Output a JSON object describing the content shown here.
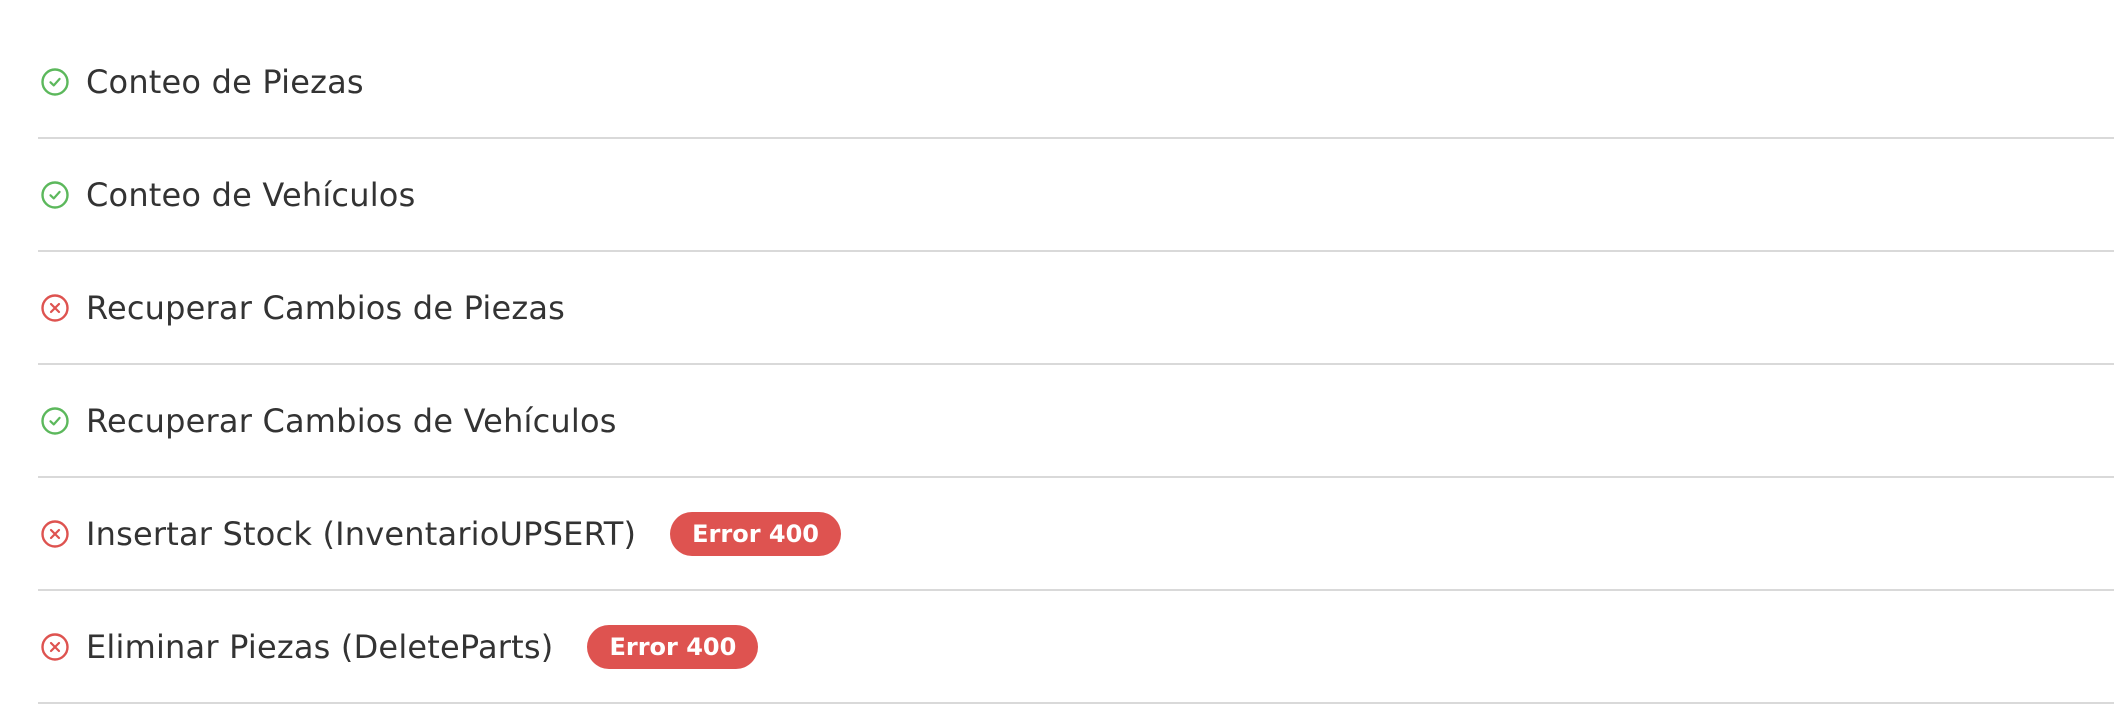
{
  "colors": {
    "success": "#5cb85c",
    "error": "#de5350",
    "text": "#333333",
    "divider": "#d9d9d9"
  },
  "items": [
    {
      "label": "Conteo de Piezas",
      "status": "success",
      "icon": "check-circle-icon",
      "badge": ""
    },
    {
      "label": "Conteo de Vehículos",
      "status": "success",
      "icon": "check-circle-icon",
      "badge": ""
    },
    {
      "label": "Recuperar Cambios de Piezas",
      "status": "error",
      "icon": "x-circle-icon",
      "badge": ""
    },
    {
      "label": "Recuperar Cambios de Vehículos",
      "status": "success",
      "icon": "check-circle-icon",
      "badge": ""
    },
    {
      "label": "Insertar Stock (InventarioUPSERT)",
      "status": "error",
      "icon": "x-circle-icon",
      "badge": "Error 400"
    },
    {
      "label": "Eliminar Piezas (DeleteParts)",
      "status": "error",
      "icon": "x-circle-icon",
      "badge": "Error 400"
    }
  ]
}
